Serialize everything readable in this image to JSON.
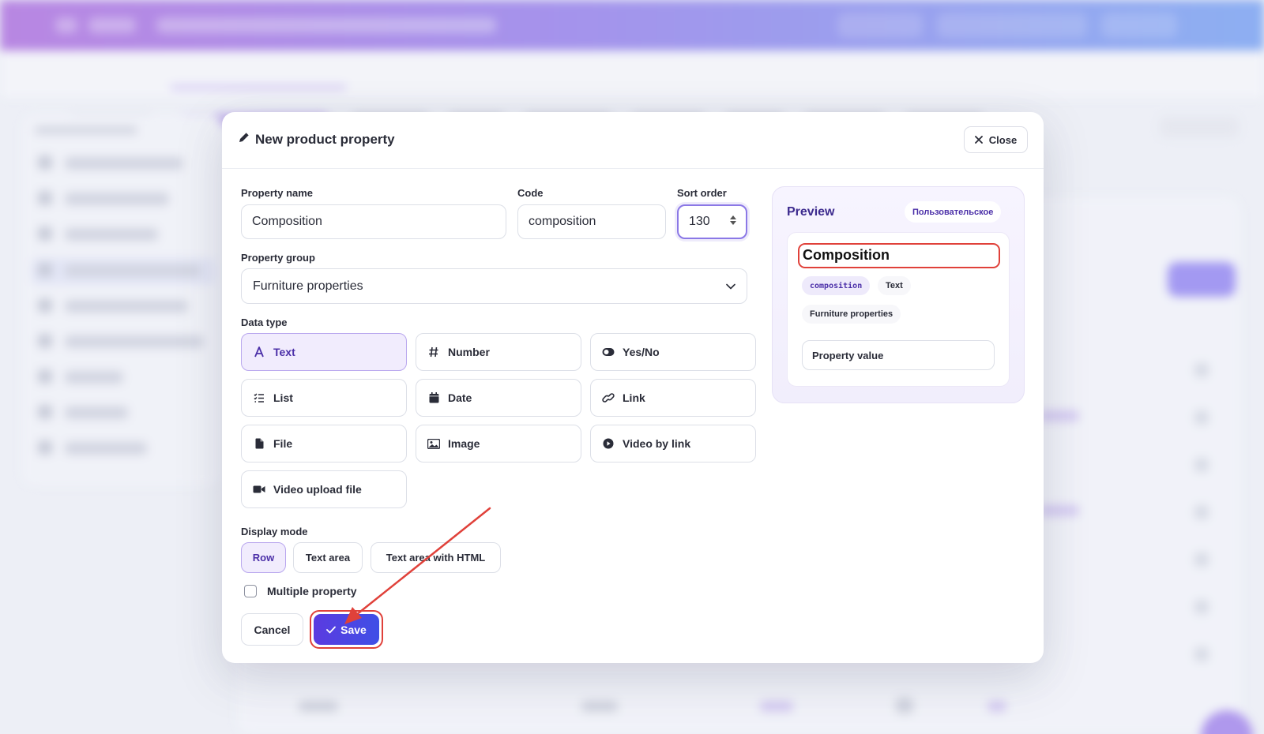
{
  "modal": {
    "title": "New product property",
    "close_label": "Close"
  },
  "form": {
    "property_name": {
      "label": "Property name",
      "value": "Composition"
    },
    "code": {
      "label": "Code",
      "value": "composition"
    },
    "sort_order": {
      "label": "Sort order",
      "value": "130"
    },
    "property_group": {
      "label": "Property group",
      "value": "Furniture properties"
    },
    "data_type": {
      "label": "Data type",
      "options": [
        {
          "label": "Text",
          "icon": "font-icon",
          "selected": true
        },
        {
          "label": "Number",
          "icon": "hash-icon",
          "selected": false
        },
        {
          "label": "Yes/No",
          "icon": "toggle-icon",
          "selected": false
        },
        {
          "label": "List",
          "icon": "list-icon",
          "selected": false
        },
        {
          "label": "Date",
          "icon": "calendar-icon",
          "selected": false
        },
        {
          "label": "Link",
          "icon": "link-icon",
          "selected": false
        },
        {
          "label": "File",
          "icon": "file-icon",
          "selected": false
        },
        {
          "label": "Image",
          "icon": "image-icon",
          "selected": false
        },
        {
          "label": "Video by link",
          "icon": "play-circle-icon",
          "selected": false
        },
        {
          "label": "Video upload file",
          "icon": "video-camera-icon",
          "selected": false
        }
      ]
    },
    "display_mode": {
      "label": "Display mode",
      "options": [
        {
          "label": "Row",
          "selected": true
        },
        {
          "label": "Text area",
          "selected": false
        },
        {
          "label": "Text area with HTML",
          "selected": false
        }
      ]
    },
    "multiple": {
      "label": "Multiple property",
      "checked": false
    },
    "cancel_label": "Cancel",
    "save_label": "Save"
  },
  "preview": {
    "title": "Preview",
    "badge": "Пользовательское",
    "name": "Composition",
    "code_chip": "composition",
    "type_chip": "Text",
    "group_chip": "Furniture properties",
    "value_placeholder": "Property value"
  },
  "colors": {
    "accent": "#5b3be0",
    "accent_light": "#f1ecfd",
    "highlight_ring": "#e0413a",
    "topbar_start": "#9d50d8",
    "topbar_end": "#5b8ef0"
  }
}
